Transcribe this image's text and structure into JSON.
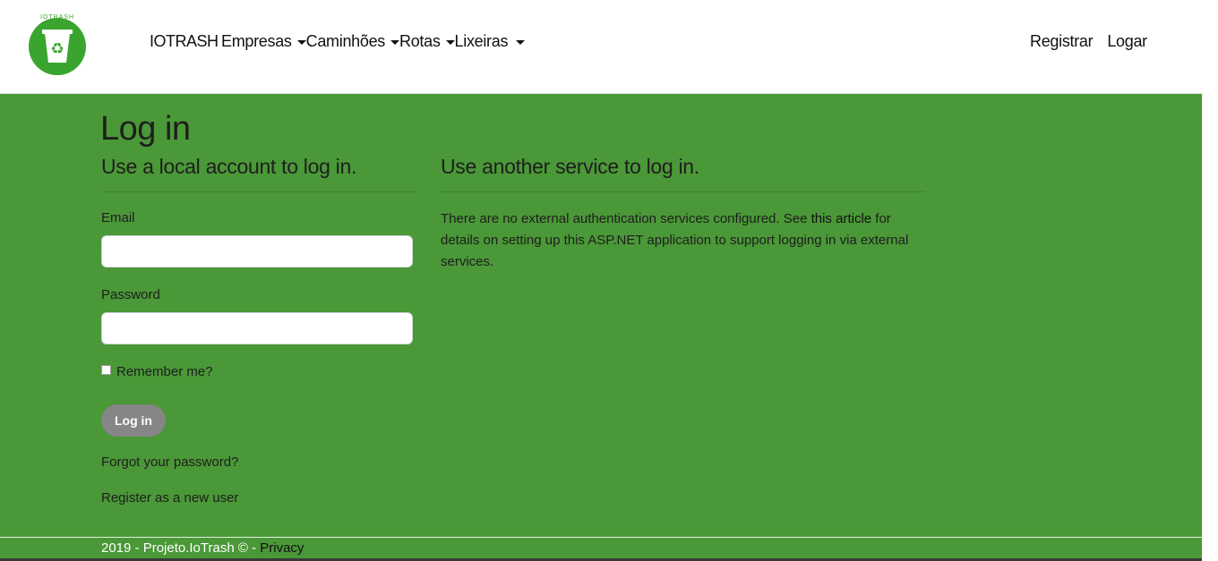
{
  "navbar": {
    "logo_text": "IOTRASH",
    "brand": "IOTRASH",
    "menu": [
      {
        "label": "Empresas"
      },
      {
        "label": "Caminhões"
      },
      {
        "label": "Rotas"
      },
      {
        "label": "Lixeiras"
      }
    ],
    "right": {
      "register": "Registrar",
      "login": "Logar"
    }
  },
  "page": {
    "title": "Log in",
    "local_heading": "Use a local account to log in.",
    "external_heading": "Use another service to log in.",
    "email_label": "Email",
    "email_value": "",
    "password_label": "Password",
    "password_value": "",
    "remember_label": "Remember me?",
    "remember_checked": false,
    "login_button": "Log in",
    "forgot_link": "Forgot your password?",
    "register_link": "Register as a new user",
    "external_text_before": "There are no external authentication services configured. See",
    "external_link": "this article",
    "external_text_after": "for details on setting up this ASP.NET application to support logging in via external services."
  },
  "footer": {
    "text": "2019 - Projeto.IoTrash © -",
    "privacy_link": "Privacy"
  },
  "colors": {
    "main_background": "#4a9837",
    "logo_green": "#3aa52e",
    "button": "#868686"
  }
}
